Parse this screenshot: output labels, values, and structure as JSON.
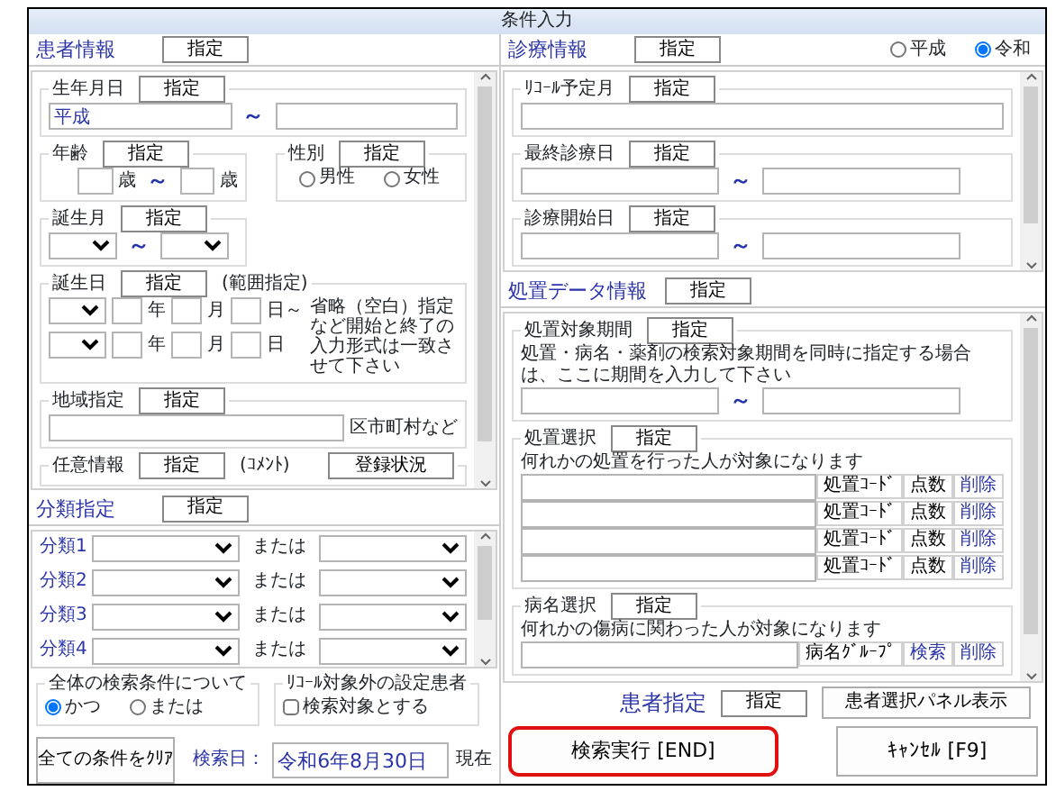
{
  "window": {
    "title": "条件入力"
  },
  "patient_info": {
    "header": "患者情報",
    "button": "指定",
    "birth_date": {
      "label": "生年月日",
      "button": "指定",
      "from_value": "平成",
      "range_mark": "～"
    },
    "age": {
      "label": "年齢",
      "button": "指定",
      "unit_from": "歳",
      "range_mark": "～",
      "unit_to": "歳"
    },
    "sex": {
      "label": "性別",
      "button": "指定",
      "options": [
        {
          "label": "男性",
          "selected": false
        },
        {
          "label": "女性",
          "selected": false
        }
      ]
    },
    "birth_month": {
      "label": "誕生月",
      "button": "指定",
      "range_mark": "～"
    },
    "birthday": {
      "label": "誕生日",
      "button": "指定",
      "legend_note": "(範囲指定)",
      "rows": [
        {
          "year": "年",
          "month": "月",
          "day": "日～"
        },
        {
          "year": "年",
          "month": "月",
          "day": "日"
        }
      ],
      "note": "省略（空白）指定など開始と終了の入力形式は一致させて下さい"
    },
    "region": {
      "label": "地域指定",
      "button": "指定",
      "suffix": "区市町村など"
    },
    "free_info": {
      "label": "任意情報",
      "button": "指定",
      "legend_note": "(ｺﾒﾝﾄ)",
      "status_button": "登録状況"
    }
  },
  "classification": {
    "header": "分類指定",
    "button": "指定",
    "rows": [
      {
        "label": "分類1",
        "or": "または"
      },
      {
        "label": "分類2",
        "or": "または"
      },
      {
        "label": "分類3",
        "or": "または"
      },
      {
        "label": "分類4",
        "or": "または"
      }
    ]
  },
  "overall_condition": {
    "label": "全体の検索条件について",
    "options": [
      {
        "label": "かつ",
        "selected": true
      },
      {
        "label": "または",
        "selected": false
      }
    ]
  },
  "recall_excluded": {
    "label": "ﾘｺｰﾙ対象外の設定患者",
    "checkbox": {
      "label": "検索対象とする",
      "checked": false
    }
  },
  "clear_button": "全ての条件をｸﾘｱ",
  "search_date": {
    "label": "検索日：",
    "value": "令和6年8月30日",
    "suffix": "現在"
  },
  "medical_info": {
    "header": "診療情報",
    "button": "指定",
    "era_options": [
      {
        "label": "平成",
        "selected": false
      },
      {
        "label": "令和",
        "selected": true
      }
    ],
    "recall_month": {
      "label": "ﾘｺｰﾙ予定月",
      "button": "指定"
    },
    "last_visit": {
      "label": "最終診療日",
      "button": "指定",
      "range_mark": "～"
    },
    "first_visit": {
      "label": "診療開始日",
      "button": "指定",
      "range_mark": "～"
    }
  },
  "treatment_info": {
    "header": "処置データ情報",
    "button": "指定",
    "period": {
      "label": "処置対象期間",
      "button": "指定",
      "note": "処置・病名・薬剤の検索対象期間を同時に指定する場合は、ここに期間を入力して下さい",
      "range_mark": "～"
    },
    "treatment_select": {
      "label": "処置選択",
      "button": "指定",
      "note": "何れかの処置を行った人が対象になります",
      "rows": [
        {
          "code": "処置ｺｰﾄﾞ",
          "points": "点数",
          "delete": "削除"
        },
        {
          "code": "処置ｺｰﾄﾞ",
          "points": "点数",
          "delete": "削除"
        },
        {
          "code": "処置ｺｰﾄﾞ",
          "points": "点数",
          "delete": "削除"
        },
        {
          "code": "処置ｺｰﾄﾞ",
          "points": "点数",
          "delete": "削除"
        }
      ]
    },
    "disease_select": {
      "label": "病名選択",
      "button": "指定",
      "note": "何れかの傷病に関わった人が対象になります",
      "rows": [
        {
          "group": "病名ｸﾞﾙｰﾌﾟ",
          "search": "検索",
          "delete": "削除"
        }
      ]
    }
  },
  "patient_select": {
    "label": "患者指定",
    "button": "指定",
    "panel_button": "患者選択パネル表示"
  },
  "actions": [
    {
      "label": "検索実行 [END]",
      "highlighted": true
    },
    {
      "label": "ｷｬﾝｾﾙ [F9]",
      "highlighted": false
    }
  ]
}
